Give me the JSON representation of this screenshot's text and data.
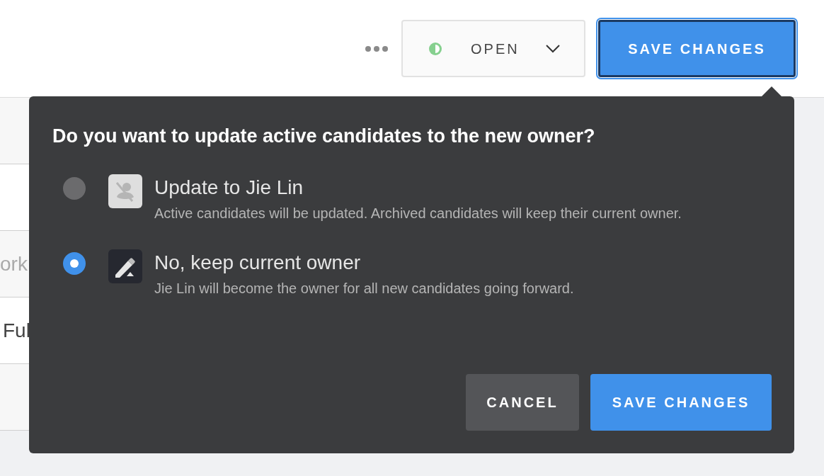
{
  "header": {
    "status": {
      "label": "OPEN"
    },
    "save_button": {
      "label": "SAVE CHANGES",
      "focused": true
    }
  },
  "background": {
    "rows": [
      {
        "kind": "gray"
      },
      {
        "kind": "white"
      },
      {
        "kind": "gray",
        "text": "ork"
      },
      {
        "kind": "white",
        "text": "Ful"
      },
      {
        "kind": "gray"
      }
    ]
  },
  "popover": {
    "question": "Do you want to update active candidates to the new owner?",
    "options": [
      {
        "title": "Update to Jie Lin",
        "description": "Active candidates will be updated. Archived candidates will keep their current owner.",
        "selected": false,
        "kind": "person"
      },
      {
        "title": "No, keep current owner",
        "description": "Jie Lin will become the owner for all new candidates going forward.",
        "selected": true,
        "kind": "pencil"
      }
    ],
    "buttons": [
      {
        "label": "CANCEL",
        "kind": "secondary"
      },
      {
        "label": "SAVE CHANGES",
        "kind": "primary"
      }
    ]
  }
}
